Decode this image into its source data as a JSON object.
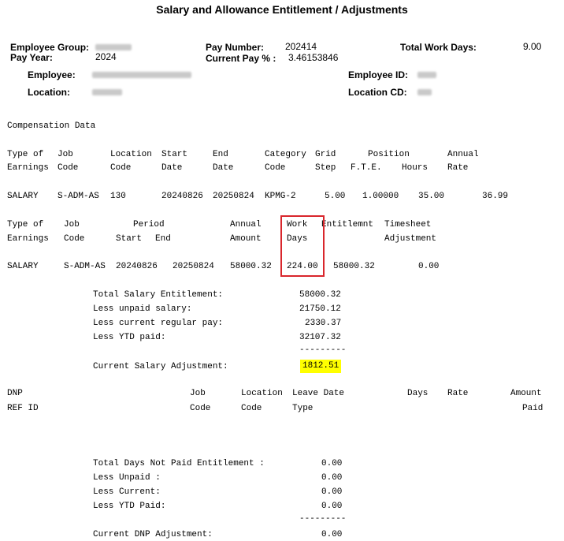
{
  "title": "Salary and Allowance Entitlement / Adjustments",
  "header": {
    "employee_group_label": "Employee Group:",
    "pay_year_label": "Pay Year:",
    "pay_year": "2024",
    "pay_number_label": "Pay Number:",
    "pay_number": "202414",
    "current_pay_pct_label": "Current Pay % :",
    "current_pay_pct": "3.46153846",
    "total_work_days_label": "Total Work Days:",
    "total_work_days": "9.00",
    "employee_label": "Employee:",
    "employee_id_label": "Employee ID:",
    "location_label": "Location:",
    "location_cd_label": "Location CD:"
  },
  "compensation": {
    "section_title": "Compensation Data",
    "h1": [
      "Type of",
      "Job",
      "Location",
      "Start",
      "End",
      "Category",
      "Grid",
      "Position",
      "Annual"
    ],
    "h2": [
      "Earnings",
      "Code",
      "Code",
      "Date",
      "Date",
      "Code",
      "Step",
      "F.T.E.",
      "Hours",
      "Rate"
    ],
    "row": [
      "SALARY",
      "S-ADM-AS",
      "130",
      "20240826",
      "20250824",
      "KPMG-2",
      "5.00",
      "1.00000",
      "35.00",
      "36.99"
    ]
  },
  "entitlement": {
    "h1": [
      "Type of",
      "Job",
      "Period",
      "Annual",
      "Work",
      "Entitlemnt",
      "Timesheet"
    ],
    "h2": [
      "Earnings",
      "Code",
      "Start",
      "End",
      "Amount",
      "Days",
      "Adjustment"
    ],
    "row": [
      "SALARY",
      "S-ADM-AS",
      "20240826",
      "20250824",
      "58000.32",
      "224.00",
      "58000.32",
      "0.00"
    ]
  },
  "salary_summary": {
    "items": [
      {
        "label": "Total Salary Entitlement:",
        "value": "58000.32"
      },
      {
        "label": "Less unpaid salary:",
        "value": "21750.12"
      },
      {
        "label": "Less current regular pay:",
        "value": "2330.37"
      },
      {
        "label": "Less YTD paid:",
        "value": "32107.32"
      }
    ],
    "separator": "---------",
    "adjustment_label": "Current Salary Adjustment:",
    "adjustment_value": "1812.51"
  },
  "dnp": {
    "h1": [
      "DNP",
      "Job",
      "Location",
      "Leave Date",
      "Days",
      "Rate",
      "Amount"
    ],
    "h2": [
      "REF ID",
      "Code",
      "Code",
      "Type",
      "Paid"
    ],
    "items": [
      {
        "label": "Total Days Not Paid Entitlement :",
        "value": "0.00"
      },
      {
        "label": "Less Unpaid :",
        "value": "0.00"
      },
      {
        "label": "Less Current:",
        "value": "0.00"
      },
      {
        "label": "Less YTD Paid:",
        "value": "0.00"
      }
    ],
    "separator": "---------",
    "adjustment_label": "Current DNP Adjustment:",
    "adjustment_value": "0.00"
  }
}
